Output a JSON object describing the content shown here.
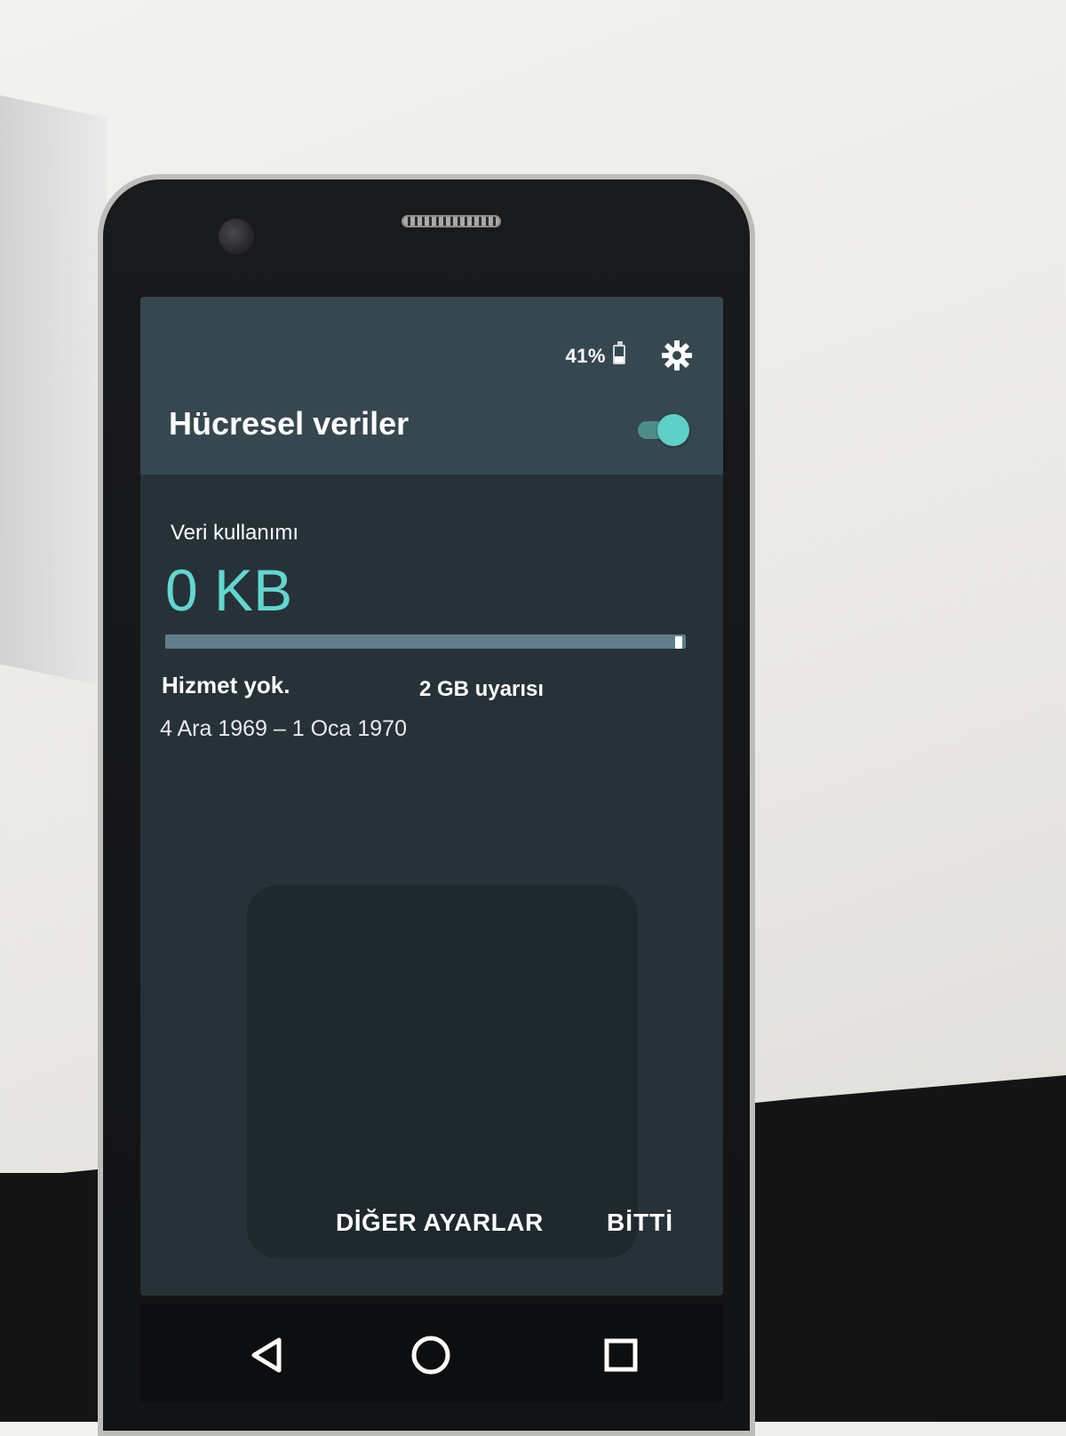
{
  "status_bar": {
    "battery_text": "41%",
    "battery_level": 0.41,
    "settings_icon": "gear-icon"
  },
  "panel": {
    "title": "Hücresel veriler",
    "toggle_on": true
  },
  "usage": {
    "label": "Veri kullanımı",
    "amount": "0 KB",
    "progress_fraction": 0.0,
    "service_status": "Hizmet yok.",
    "warning": "2 GB uyarısı",
    "date_range": "4 Ara 1969 – 1 Oca 1970"
  },
  "actions": {
    "more_settings_label": "DİĞER AYARLAR",
    "done_label": "BİTTİ"
  },
  "navigation": {
    "back_icon": "back-triangle-icon",
    "home_icon": "home-circle-icon",
    "recents_icon": "recents-square-icon"
  },
  "colors": {
    "accent": "#62d6cf",
    "header_bg": "#37474f",
    "panel_bg": "#263238"
  }
}
